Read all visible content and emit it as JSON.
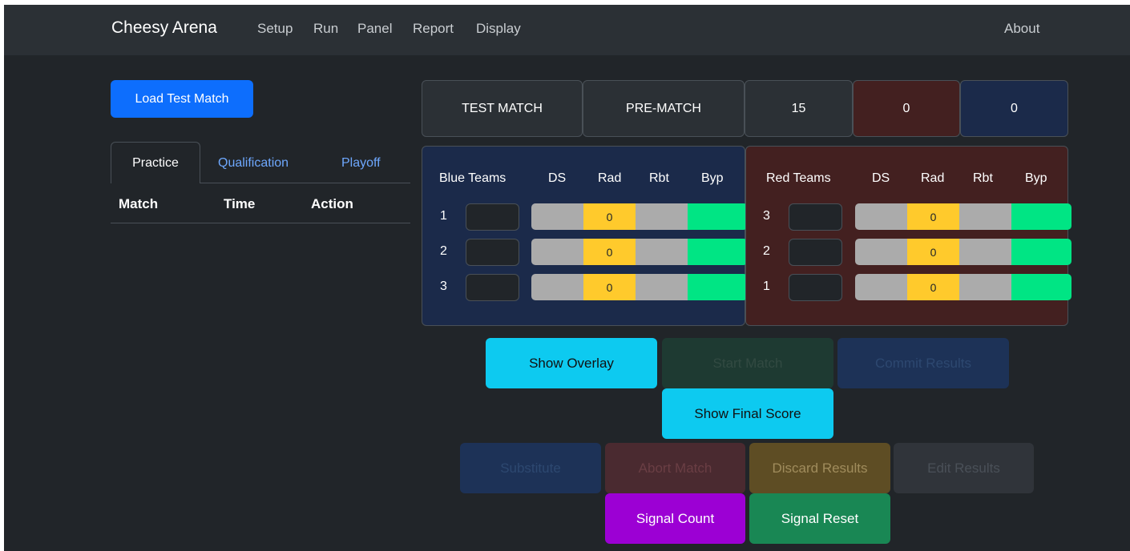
{
  "navbar": {
    "brand": "Cheesy Arena",
    "links": [
      "Setup",
      "Run",
      "Panel",
      "Report",
      "Display"
    ],
    "about": "About"
  },
  "left": {
    "load_button": "Load Test Match",
    "tabs": [
      "Practice",
      "Qualification",
      "Playoff"
    ],
    "active_tab": "Practice",
    "columns": [
      "Match",
      "Time",
      "Action"
    ]
  },
  "status": {
    "match_name": "TEST MATCH",
    "match_state": "PRE-MATCH",
    "time": "15",
    "red_score": "0",
    "blue_score": "0"
  },
  "blue": {
    "headers": [
      "Blue Teams",
      "DS",
      "Rad",
      "Rbt",
      "Byp"
    ],
    "rows": [
      {
        "position": "1",
        "team": "",
        "value": "0"
      },
      {
        "position": "2",
        "team": "",
        "value": "0"
      },
      {
        "position": "3",
        "team": "",
        "value": "0"
      }
    ]
  },
  "red": {
    "headers": [
      "Red Teams",
      "DS",
      "Rad",
      "Rbt",
      "Byp"
    ],
    "rows": [
      {
        "position": "3",
        "team": "",
        "value": "0"
      },
      {
        "position": "2",
        "team": "",
        "value": "0"
      },
      {
        "position": "1",
        "team": "",
        "value": "0"
      }
    ]
  },
  "controls": {
    "show_overlay": "Show Overlay",
    "start_match": "Start Match",
    "commit_results": "Commit Results",
    "show_final_score": "Show Final Score",
    "substitute": "Substitute",
    "abort_match": "Abort Match",
    "discard_results": "Discard Results",
    "edit_results": "Edit Results",
    "signal_count": "Signal Count",
    "signal_reset": "Signal Reset"
  },
  "colors": {
    "primary": "#0d6efd",
    "info": "#0dcaf0",
    "blue_alliance": "#1b2a4a",
    "red_alliance": "#432020",
    "status_ok": "#00e584",
    "status_warn": "#ffca2c"
  }
}
